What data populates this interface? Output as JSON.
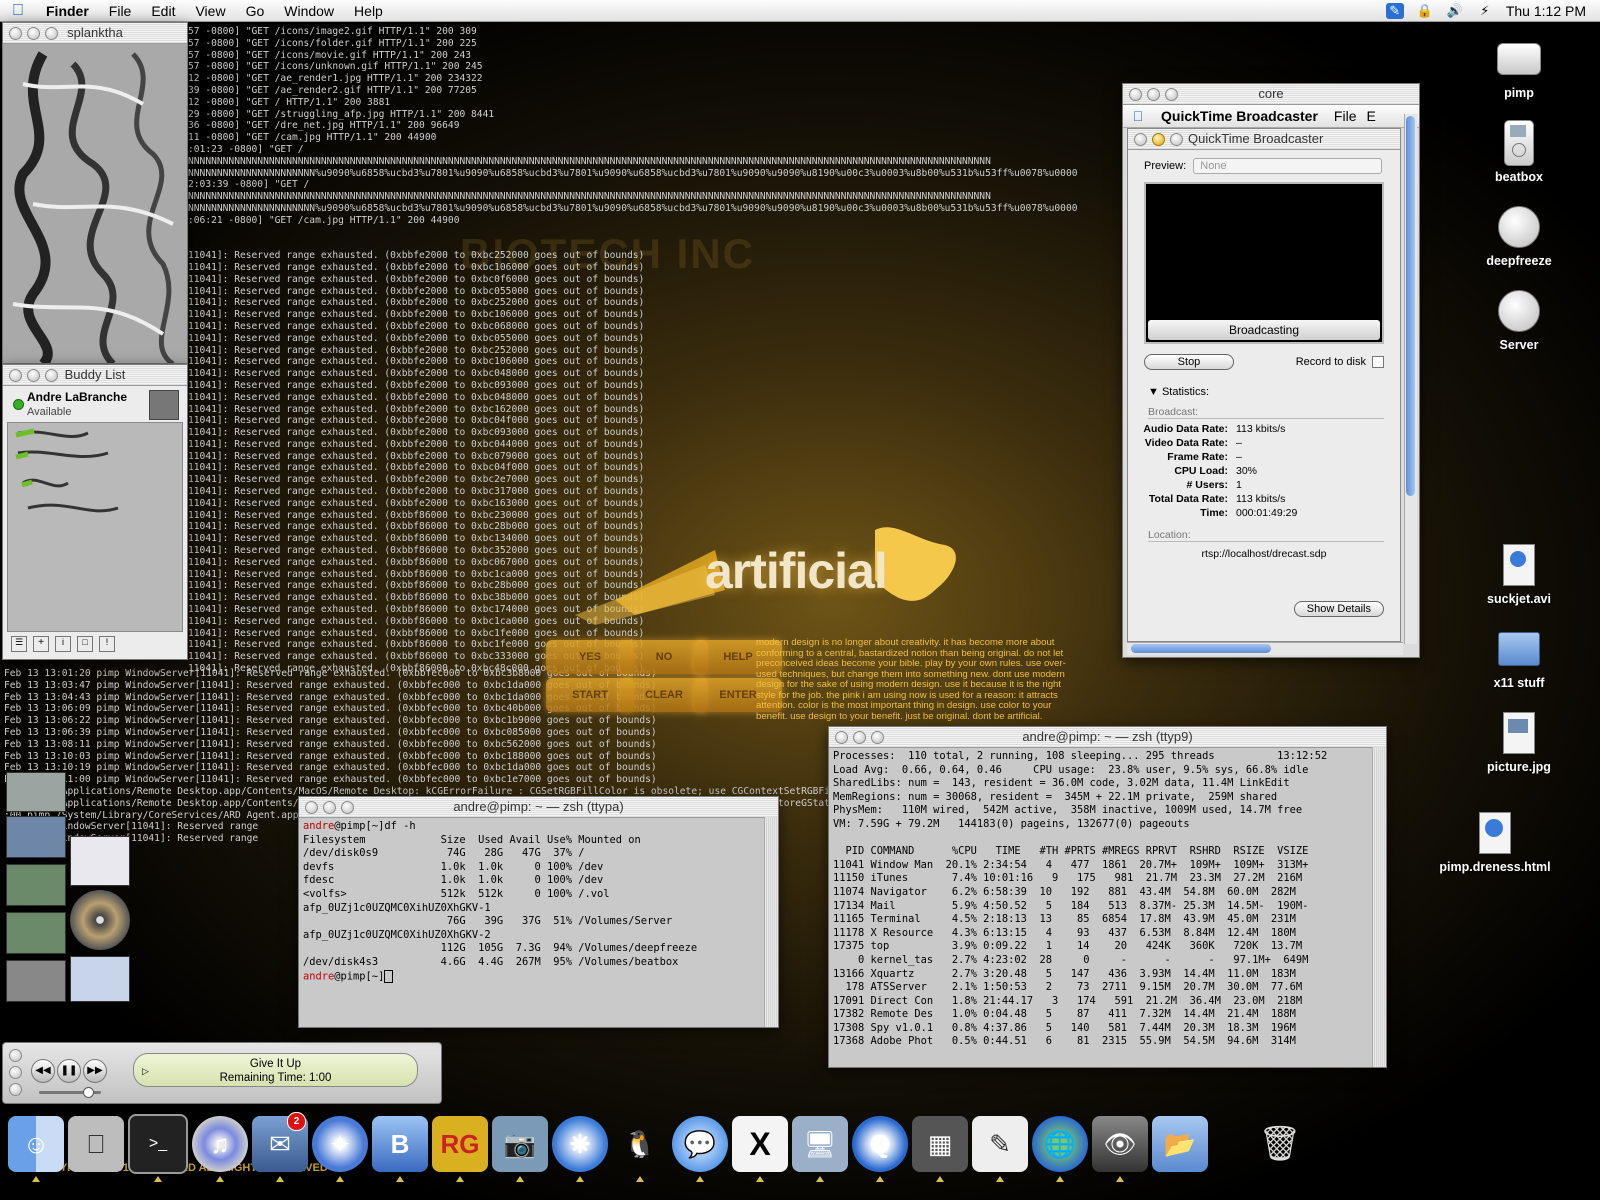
{
  "menubar": {
    "app": "Finder",
    "items": [
      "File",
      "Edit",
      "View",
      "Go",
      "Window",
      "Help"
    ],
    "clock": "Thu 1:12 PM"
  },
  "background_log": {
    "lines": [
      "57 -0800] \"GET /icons/image2.gif HTTP/1.1\" 200 309",
      "57 -0800] \"GET /icons/folder.gif HTTP/1.1\" 200 225",
      "57 -0800] \"GET /icons/movie.gif HTTP/1.1\" 200 243",
      "57 -0800] \"GET /icons/unknown.gif HTTP/1.1\" 200 245",
      "12 -0800] \"GET /ae_render1.jpg HTTP/1.1\" 200 234322",
      "39 -0800] \"GET /ae_render2.gif HTTP/1.1\" 200 77205",
      "12 -0800] \"GET / HTTP/1.1\" 200 3881",
      "29 -0800] \"GET /struggling_afp.jpg HTTP/1.1\" 200 8441",
      "36 -0800] \"GET /dre_net.jpg HTTP/1.1\" 200 96649",
      "11 -0800] \"GET /cam.jpg HTTP/1.1\" 200 44900",
      ":01:23 -0800] \"GET /",
      "NNNNNNNNNNNNNNNNNNNNNNNNNNNNNNNNNNNNNNNNNNNNNNNNNNNNNNNNNNNNNNNNNNNNNNNNNNNNNNNNNNNNNNNNNNNNNNNNNNNNNNNNNNNNNNNNNNNNNNNNNNNNNNNNNNNNNNNNNNN",
      "NNNNNNNNNNNNNNNNNNNNNN%u9090%u6858%ucbd3%u7801%u9090%u6858%ucbd3%u7801%u9090%u6858%ucbd3%u7801%u9090%u9090%u8190%u00c3%u0003%u8b00%u531b%u53ff%u0078%u0000",
      "2:03:39 -0800] \"GET /",
      "NNNNNNNNNNNNNNNNNNNNNNNNNNNNNNNNNNNNNNNNNNNNNNNNNNNNNNNNNNNNNNNNNNNNNNNNNNNNNNNNNNNNNNNNNNNNNNNNNNNNNNNNNNNNNNNNNNNNNNNNNNNNNNNNNNNNNNNNNNN",
      "NNNNNNNNNNNNNNNNNNNNNN%u9090%u6858%ucbd3%u7801%u9090%u6858%ucbd3%u7801%u9090%u6858%ucbd3%u7801%u9090%u9090%u8190%u00c3%u0003%u8b00%u531b%u53ff%u0078%u0000",
      ":06:21 -0800] \"GET /cam.jpg HTTP/1.1\" 200 44900",
      "",
      "",
      "11041]: Reserved range exhausted. (0xbbfe2000 to 0xbc252000 goes out of bounds)",
      "11041]: Reserved range exhausted. (0xbbfe2000 to 0xbc106000 goes out of bounds)",
      "11041]: Reserved range exhausted. (0xbbfe2000 to 0xbc0f6000 goes out of bounds)",
      "11041]: Reserved range exhausted. (0xbbfe2000 to 0xbc055000 goes out of bounds)",
      "11041]: Reserved range exhausted. (0xbbfe2000 to 0xbc252000 goes out of bounds)",
      "11041]: Reserved range exhausted. (0xbbfe2000 to 0xbc106000 goes out of bounds)",
      "11041]: Reserved range exhausted. (0xbbfe2000 to 0xbc068000 goes out of bounds)",
      "11041]: Reserved range exhausted. (0xbbfe2000 to 0xbc055000 goes out of bounds)",
      "11041]: Reserved range exhausted. (0xbbfe2000 to 0xbc252000 goes out of bounds)",
      "11041]: Reserved range exhausted. (0xbbfe2000 to 0xbc106000 goes out of bounds)",
      "11041]: Reserved range exhausted. (0xbbfe2000 to 0xbc048000 goes out of bounds)",
      "11041]: Reserved range exhausted. (0xbbfe2000 to 0xbc093000 goes out of bounds)",
      "11041]: Reserved range exhausted. (0xbbfe2000 to 0xbc048000 goes out of bounds)",
      "11041]: Reserved range exhausted. (0xbbfe2000 to 0xbc162000 goes out of bounds)",
      "11041]: Reserved range exhausted. (0xbbfe2000 to 0xbc04f000 goes out of bounds)",
      "11041]: Reserved range exhausted. (0xbbfe2000 to 0xbc093000 goes out of bounds)",
      "11041]: Reserved range exhausted. (0xbbfe2000 to 0xbc044000 goes out of bounds)",
      "11041]: Reserved range exhausted. (0xbbfe2000 to 0xbc079000 goes out of bounds)",
      "11041]: Reserved range exhausted. (0xbbfe2000 to 0xbc04f000 goes out of bounds)",
      "11041]: Reserved range exhausted. (0xbbfe2000 to 0xbc2e7000 goes out of bounds)",
      "11041]: Reserved range exhausted. (0xbbfe2000 to 0xbc317000 goes out of bounds)",
      "11041]: Reserved range exhausted. (0xbbfe2000 to 0xbc163000 goes out of bounds)",
      "11041]: Reserved range exhausted. (0xbbf86000 to 0xbc230000 goes out of bounds)",
      "11041]: Reserved range exhausted. (0xbbf86000 to 0xbc28b000 goes out of bounds)",
      "11041]: Reserved range exhausted. (0xbbf86000 to 0xbc134000 goes out of bounds)",
      "11041]: Reserved range exhausted. (0xbbf86000 to 0xbc352000 goes out of bounds)",
      "11041]: Reserved range exhausted. (0xbbf86000 to 0xbc067000 goes out of bounds)",
      "11041]: Reserved range exhausted. (0xbbf86000 to 0xbc1ca000 goes out of bounds)",
      "11041]: Reserved range exhausted. (0xbbf86000 to 0xbc28b000 goes out of bounds)",
      "11041]: Reserved range exhausted. (0xbbf86000 to 0xbc38b000 goes out of bounds)",
      "11041]: Reserved range exhausted. (0xbbf86000 to 0xbc174000 goes out of bounds)",
      "11041]: Reserved range exhausted. (0xbbf86000 to 0xbc1ca000 goes out of bounds)",
      "11041]: Reserved range exhausted. (0xbbf86000 to 0xbc1fe000 goes out of bounds)",
      "11041]: Reserved range exhausted. (0xbbf86000 to 0xbc1fe000 goes out of bounds)",
      "11041]: Reserved range exhausted. (0xbbf86000 to 0xbc333000 goes out of bounds)",
      "11041]: Reserved range exhausted. (0xbbf86000 to 0xbc48c000 goes out of bounds)"
    ],
    "lower_lines": [
      "Feb 13 13:01:20 pimp WindowServer[11041]: Reserved range exhausted. (0xbbfec000 to 0xbc3b8000 goes out of bounds)",
      "Feb 13 13:03:47 pimp WindowServer[11041]: Reserved range exhausted. (0xbbfec000 to 0xbc1da000 goes out of bounds)",
      "Feb 13 13:04:43 pimp WindowServer[11041]: Reserved range exhausted. (0xbbfec000 to 0xbc1da000 goes out of bounds)",
      "Feb 13 13:06:09 pimp WindowServer[11041]: Reserved range exhausted. (0xbbfec000 to 0xbc40b000 goes out of bounds)",
      "Feb 13 13:06:22 pimp WindowServer[11041]: Reserved range exhausted. (0xbbfec000 to 0xbc1b9000 goes out of bounds)",
      "Feb 13 13:06:39 pimp WindowServer[11041]: Reserved range exhausted. (0xbbfec000 to 0xbc085000 goes out of bounds)",
      "Feb 13 13:08:11 pimp WindowServer[11041]: Reserved range exhausted. (0xbbfec000 to 0xbc562000 goes out of bounds)",
      "Feb 13 13:10:03 pimp WindowServer[11041]: Reserved range exhausted. (0xbbfec000 to 0xbc188000 goes out of bounds)",
      "Feb 13 13:10:19 pimp WindowServer[11041]: Reserved range exhausted. (0xbbfec000 to 0xbc1da000 goes out of bounds)",
      "Feb 13 13:11:00 pimp WindowServer[11041]: Reserved range exhausted. (0xbbfec000 to 0xbc1e7000 goes out of bounds)",
      ":00 pimp /Applications/Remote Desktop.app/Contents/MacOS/Remote Desktop: kCGErrorFailure : CGSetRGBFillColor is obsolete; use CGContextSetRGBFillColor",
      ":00 pimp /Applications/Remote Desktop.app/Contents/MacOS/Remote Desktop: kCGErrorFailure : CGSetGContext is obsolete; use CGContextRestoreGState instead.",
      ":00 pimp /System/Library/CoreServices/ARD Agent.app/Contents/MacOS/ARDAgent: ... administration",
      ":00 pimp WindowServer[11041]: Reserved range",
      ":07 pimp WindowServer[11041]: Reserved range",
      ":37 pimp WindowServer[11041]: Reserved range"
    ],
    "feb13": "Feb 13"
  },
  "watermark": "BIOTECH INC",
  "splanktha": {
    "title": "splanktha"
  },
  "buddy_list": {
    "title": "Buddy List",
    "name": "Andre LaBranche",
    "status": "Available"
  },
  "itunes": {
    "song": "Give It Up",
    "remaining": "Remaining Time: 1:00"
  },
  "artificial": {
    "logo": "artificial",
    "buttons": [
      "YES",
      "NO",
      "HELP",
      "START",
      "CLEAR",
      "ENTER"
    ],
    "text": "modern design is no longer about creativity. it has become more about conforming to a central, bastardized notion than being original. do not let preconceived ideas become your bible. play by your own rules. use over-used techniques, but change them into something new. dont use modern design for the sake of using modern design. use it because it is the right style for the job. the pink i am using now is used for a reason: it attracts attention. color is the most important thing in design. use color to your benefit. use design to your benefit. just be original. dont be artificial.",
    "copyright": "COPYRIGHT 2001 RYAN FORD ALL RIGHTS RESERVED"
  },
  "core_window": {
    "title": "core",
    "app_menu": "QuickTime Broadcaster",
    "menu_file": "File",
    "menu_clip": "E",
    "inner_title": "QuickTime Broadcaster",
    "preview_label": "Preview:",
    "preview_value": "None",
    "broadcasting": "Broadcasting",
    "stop": "Stop",
    "record_to_disk": "Record to disk",
    "statistics": "Statistics:",
    "broadcast_label": "Broadcast:",
    "stats": [
      {
        "label": "Audio Data Rate:",
        "value": "113 kbits/s"
      },
      {
        "label": "Video Data Rate:",
        "value": "–"
      },
      {
        "label": "Frame Rate:",
        "value": "–"
      },
      {
        "label": "CPU Load:",
        "value": "30%"
      },
      {
        "label": "# Users:",
        "value": "1"
      },
      {
        "label": "Total Data Rate:",
        "value": "113 kbits/s"
      },
      {
        "label": "Time:",
        "value": "000:01:49:29"
      }
    ],
    "location_label": "Location:",
    "location_value": "rtsp://localhost/drecast.sdp",
    "show_details": "Show Details"
  },
  "zsh_ttypa": {
    "title": "andre@pimp: ~ — zsh (ttypa)",
    "user": "andre",
    "prompt_rest": "@pimp[~]df -h",
    "lines": [
      "Filesystem            Size  Used Avail Use% Mounted on",
      "/dev/disk0s9           74G   28G   47G  37% /",
      "devfs                 1.0k  1.0k     0 100% /dev",
      "fdesc                 1.0k  1.0k     0 100% /dev",
      "<volfs>               512k  512k     0 100% /.vol",
      "afp_0UZj1c0UZQMC0XihUZ0XhGKV-1",
      "                       76G   39G   37G  51% /Volumes/Server",
      "afp_0UZj1c0UZQMC0XihUZ0XhGKV-2",
      "                      112G  105G  7.3G  94% /Volumes/deepfreeze",
      "/dev/disk4s3          4.6G  4.4G  267M  95% /Volumes/beatbox"
    ],
    "prompt_end": "@pimp[~]"
  },
  "zsh_ttyp9": {
    "title": "andre@pimp: ~ — zsh (ttyp9)",
    "lines": [
      "Processes:  110 total, 2 running, 108 sleeping... 295 threads          13:12:52",
      "Load Avg:  0.66, 0.64, 0.46     CPU usage:  23.8% user, 9.5% sys, 66.8% idle",
      "SharedLibs: num =  143, resident = 36.0M code, 3.02M data, 11.4M LinkEdit",
      "MemRegions: num = 30068, resident =  345M + 22.1M private,  259M shared",
      "PhysMem:   110M wired,  542M active,  358M inactive, 1009M used, 14.7M free",
      "VM: 7.59G + 79.2M   144183(0) pageins, 132677(0) pageouts",
      "",
      "  PID COMMAND      %CPU   TIME   #TH #PRTS #MREGS RPRVT  RSHRD  RSIZE  VSIZE",
      "11041 Window Man  20.1% 2:34:54   4   477  1861  20.7M+  109M+  109M+  313M+",
      "11150 iTunes       7.4% 10:01:16   9   175   981  21.7M  23.3M  27.2M  216M",
      "11074 Navigator    6.2% 6:58:39  10   192   881  43.4M  54.8M  60.0M  282M",
      "17134 Mail         5.9% 4:50.52   5   184   513  8.37M- 25.3M  14.5M-  190M-",
      "11165 Terminal     4.5% 2:18:13  13    85  6854  17.8M  43.9M  45.0M  231M",
      "11178 X Resource   4.3% 6:13:15   4    93   437  6.53M  8.84M  12.4M  180M",
      "17375 top          3.9% 0:09.22   1    14    20   424K   360K   720K  13.7M",
      "    0 kernel_tas   2.7% 4:23:02  28     0     -      -      -   97.1M+  649M",
      "13166 Xquartz      2.7% 3:20.48   5   147   436  3.93M  14.4M  11.0M  183M",
      "  178 ATSServer    2.1% 1:50:53   2    73  2711  9.15M  20.7M  30.0M  77.6M",
      "17091 Direct Con   1.8% 21:44.17   3   174   591  21.2M  36.4M  23.0M  218M",
      "17382 Remote Des   1.0% 0:04.48   5    87   411  7.32M  14.4M  21.4M  188M",
      "17308 Spy v1.0.1   0.8% 4:37.86   5   140   581  7.44M  20.3M  18.3M  196M",
      "17368 Adobe Phot   0.5% 0:44.51   6    81  2315  55.9M  54.5M  94.6M  314M"
    ]
  },
  "desktop_icons": [
    {
      "label": "pimp",
      "icon": "hard-drive-icon"
    },
    {
      "label": "beatbox",
      "icon": "ipod-icon"
    },
    {
      "label": "deepfreeze",
      "icon": "network-volume-icon"
    },
    {
      "label": "Server",
      "icon": "network-volume-icon"
    },
    {
      "label": "suckjet.avi",
      "icon": "movie-file-icon"
    },
    {
      "label": "x11 stuff",
      "icon": "folder-icon"
    },
    {
      "label": "picture.jpg",
      "icon": "jpeg-file-icon"
    },
    {
      "label": "pimp.dreness.html",
      "icon": "html-file-icon"
    }
  ],
  "dock": {
    "mail_badge": "2",
    "items": [
      "finder-icon",
      "system-prefs-icon",
      "terminal-icon",
      "itunes-icon",
      "mail-icon",
      "navigator-icon",
      "bbedit-icon",
      "rg-icon",
      "preview-icon",
      "safari-icon",
      "penguin-icon",
      "ichat-icon",
      "x11-icon",
      "remote-desktop-icon",
      "quicktime-icon",
      "grab-icon",
      "textedit-icon",
      "globe-icon",
      "eye-icon",
      "folder-icon",
      "trash-icon"
    ]
  },
  "colors": {
    "accent_yellow": "#f0c040",
    "prompt_red": "#c20000"
  }
}
